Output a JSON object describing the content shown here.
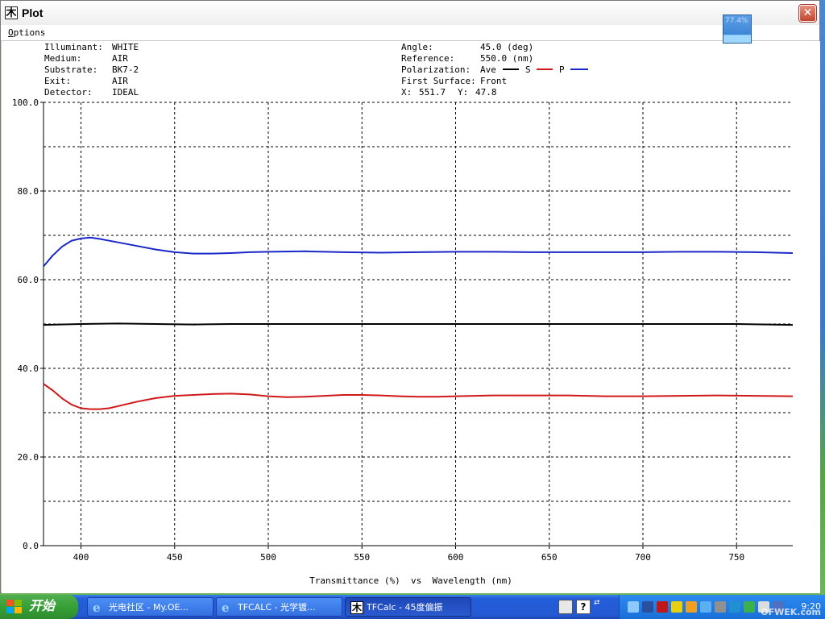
{
  "window": {
    "title": "Plot",
    "app_icon": "tfcalc-icon",
    "close_icon": "close-icon"
  },
  "menu": {
    "options_first": "O",
    "options_rest": "ptions"
  },
  "info_left": [
    {
      "key": "Illuminant:",
      "value": "WHITE"
    },
    {
      "key": "Medium:",
      "value": "AIR"
    },
    {
      "key": "Substrate:",
      "value": "BK7-2"
    },
    {
      "key": "Exit:",
      "value": "AIR"
    },
    {
      "key": "Detector:",
      "value": "IDEAL"
    }
  ],
  "info_right": {
    "angle_key": "Angle:",
    "angle_value": "45.0 (deg)",
    "reference_key": "Reference:",
    "reference_value": "550.0 (nm)",
    "polarization_key": "Polarization:",
    "pol_ave": "Ave",
    "pol_s": "S",
    "pol_p": "P",
    "surface_key": "First Surface:",
    "surface_value": "Front",
    "x_label": "X:",
    "x_value": "551.7",
    "y_label": "Y:",
    "y_value": "47.8"
  },
  "floater": {
    "text": "77.4%"
  },
  "taskbar": {
    "start_label": "开始",
    "tasks": [
      {
        "label": "光电社区 - My.OE...",
        "icon": "ie-icon"
      },
      {
        "label": "TFCALC - 光学镀...",
        "icon": "ie-icon"
      },
      {
        "label": "TFCalc - 45度偏振",
        "icon": "tfcalc-icon"
      }
    ],
    "clock": "9:20",
    "watermark": "OFWEK.com"
  },
  "colors": {
    "ave": "#000000",
    "s": "#d01818",
    "p": "#1a28c8",
    "grid": "#000000"
  },
  "chart_data": {
    "type": "line",
    "xlabel": "Transmittance (%)  vs  Wavelength (nm)",
    "ylabel": "",
    "xlim": [
      380,
      780
    ],
    "ylim": [
      0,
      100
    ],
    "x_ticks": [
      "400",
      "450",
      "500",
      "550",
      "600",
      "650",
      "700",
      "750"
    ],
    "x_tick_values": [
      400,
      450,
      500,
      550,
      600,
      650,
      700,
      750
    ],
    "y_ticks": [
      "0.0",
      "20.0",
      "40.0",
      "60.0",
      "80.0",
      "100.0"
    ],
    "y_tick_values": [
      0,
      20,
      40,
      60,
      80,
      100
    ],
    "y_minor": [
      10,
      30,
      50,
      70,
      90
    ],
    "grid": true,
    "series": [
      {
        "name": "Ave",
        "key": "ave",
        "x": [
          380,
          400,
          420,
          440,
          460,
          480,
          500,
          550,
          600,
          650,
          700,
          750,
          780
        ],
        "y": [
          49.8,
          50.0,
          50.1,
          50.0,
          49.9,
          50.0,
          50.0,
          50.0,
          50.0,
          50.0,
          50.0,
          50.0,
          49.8
        ]
      },
      {
        "name": "S",
        "key": "s",
        "x": [
          380,
          385,
          390,
          395,
          400,
          405,
          410,
          415,
          420,
          430,
          440,
          450,
          460,
          470,
          480,
          490,
          500,
          510,
          520,
          530,
          540,
          550,
          560,
          570,
          580,
          590,
          600,
          610,
          620,
          640,
          660,
          680,
          700,
          720,
          740,
          760,
          780
        ],
        "y": [
          36.5,
          35.0,
          33.2,
          31.8,
          31.0,
          30.8,
          30.8,
          31.0,
          31.5,
          32.5,
          33.3,
          33.8,
          34.0,
          34.2,
          34.3,
          34.1,
          33.7,
          33.5,
          33.6,
          33.8,
          34.0,
          34.0,
          33.9,
          33.7,
          33.6,
          33.6,
          33.7,
          33.8,
          33.9,
          33.9,
          33.9,
          33.7,
          33.7,
          33.8,
          33.9,
          33.8,
          33.7
        ]
      },
      {
        "name": "P",
        "key": "p",
        "x": [
          380,
          385,
          390,
          395,
          400,
          405,
          410,
          420,
          430,
          440,
          450,
          460,
          470,
          480,
          490,
          500,
          520,
          540,
          560,
          580,
          600,
          620,
          640,
          660,
          680,
          700,
          720,
          740,
          760,
          780
        ],
        "y": [
          63.0,
          65.5,
          67.5,
          68.8,
          69.3,
          69.5,
          69.2,
          68.4,
          67.6,
          66.8,
          66.2,
          65.9,
          65.9,
          66.0,
          66.2,
          66.3,
          66.4,
          66.2,
          66.1,
          66.2,
          66.3,
          66.3,
          66.2,
          66.2,
          66.2,
          66.2,
          66.3,
          66.3,
          66.2,
          66.0
        ]
      }
    ]
  }
}
